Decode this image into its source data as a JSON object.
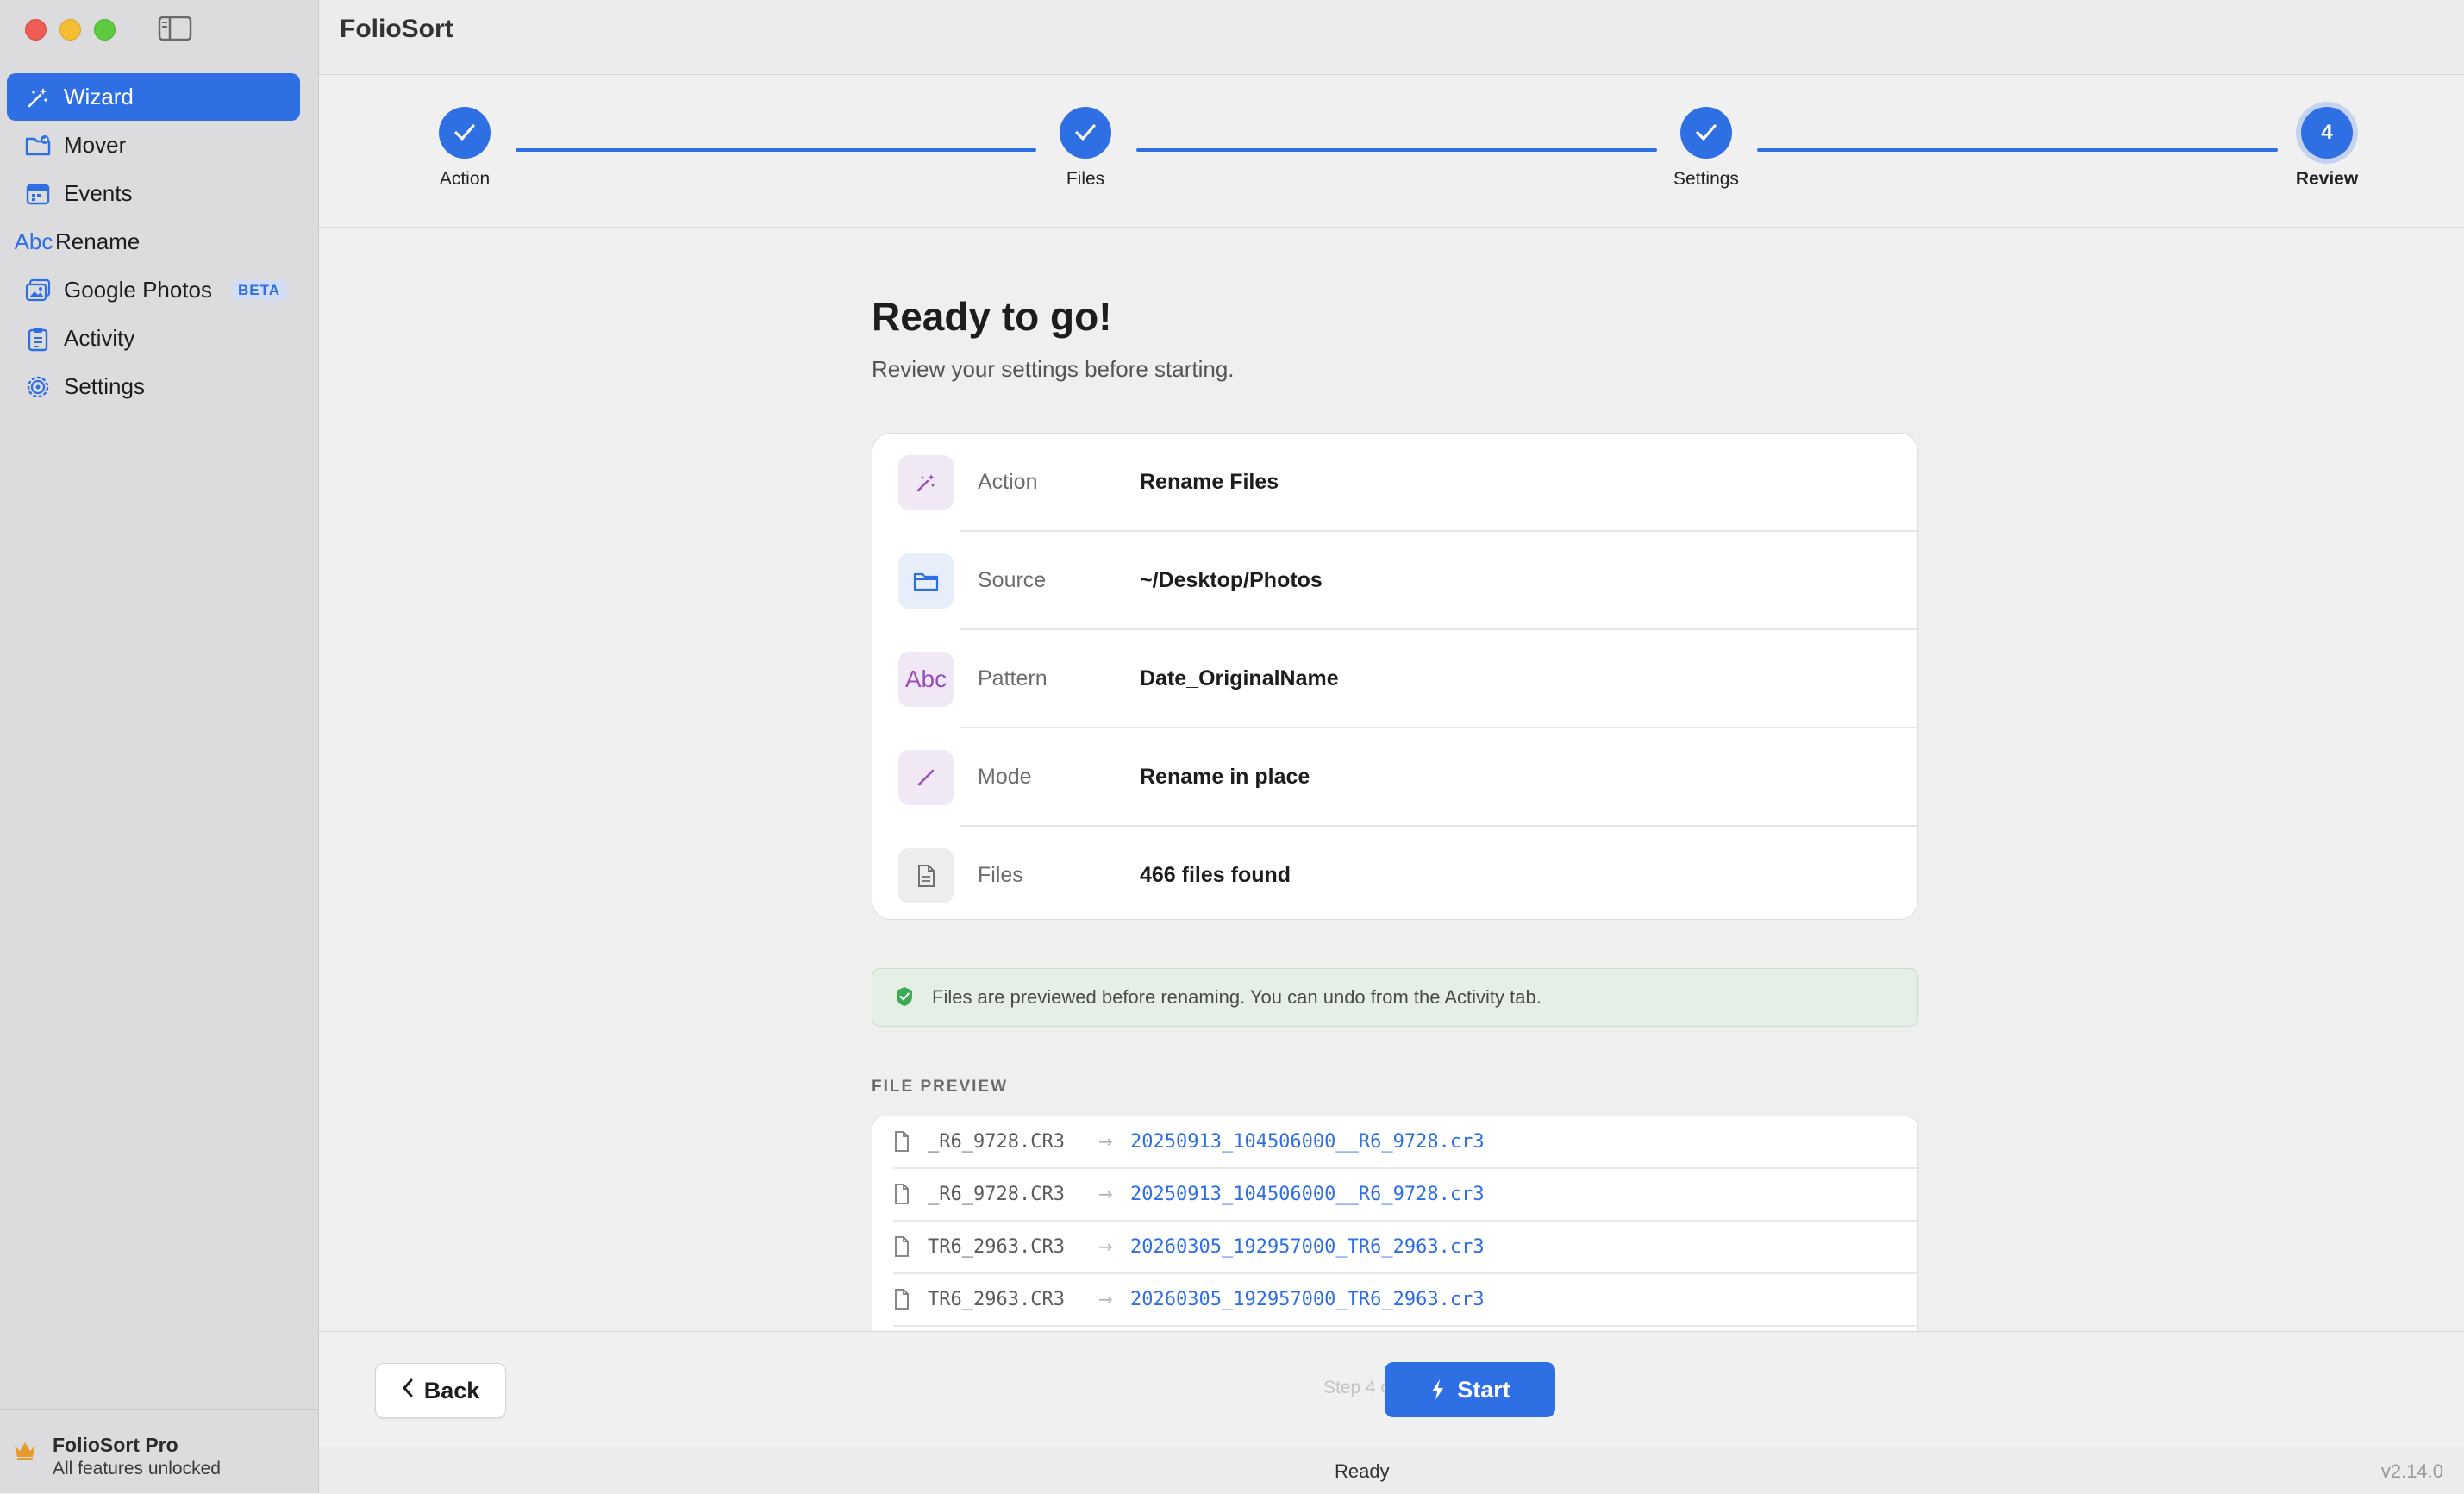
{
  "app": {
    "title": "FolioSort"
  },
  "sidebar": {
    "items": [
      {
        "label": "Wizard",
        "icon": "wand-icon",
        "active": true
      },
      {
        "label": "Mover",
        "icon": "folder-move-icon"
      },
      {
        "label": "Events",
        "icon": "calendar-icon"
      },
      {
        "label": "Rename",
        "icon": "abc-icon",
        "icon_text": "Abc"
      },
      {
        "label": "Google Photos",
        "icon": "photos-icon",
        "badge": "BETA"
      },
      {
        "label": "Activity",
        "icon": "clipboard-icon"
      },
      {
        "label": "Settings",
        "icon": "gear-icon"
      }
    ],
    "footer": {
      "title": "FolioSort Pro",
      "subtitle": "All features unlocked",
      "icon": "crown-icon"
    }
  },
  "stepper": {
    "steps": [
      {
        "label": "Action",
        "state": "done"
      },
      {
        "label": "Files",
        "state": "done"
      },
      {
        "label": "Settings",
        "state": "done"
      },
      {
        "label": "Review",
        "state": "current",
        "number": "4"
      }
    ]
  },
  "review": {
    "title": "Ready to go!",
    "subtitle": "Review your settings before starting.",
    "rows": [
      {
        "label": "Action",
        "value": "Rename Files",
        "icon": "wand-icon"
      },
      {
        "label": "Source",
        "value": "~/Desktop/Photos",
        "icon": "folder-icon"
      },
      {
        "label": "Pattern",
        "value": "Date_OriginalName",
        "icon": "abc-icon",
        "icon_text": "Abc"
      },
      {
        "label": "Mode",
        "value": "Rename in place",
        "icon": "pencil-icon"
      },
      {
        "label": "Files",
        "value": "466 files found",
        "icon": "document-icon"
      }
    ],
    "notice": "Files are previewed before renaming. You can undo from the Activity tab."
  },
  "file_preview": {
    "label": "FILE PREVIEW",
    "arrow": "→",
    "rows": [
      {
        "old": "_R6_9728.CR3",
        "new": "20250913_104506000__R6_9728.cr3"
      },
      {
        "old": "_R6_9728.CR3",
        "new": "20250913_104506000__R6_9728.cr3"
      },
      {
        "old": "TR6_2963.CR3",
        "new": "20260305_192957000_TR6_2963.cr3"
      },
      {
        "old": "TR6_2963.CR3",
        "new": "20260305_192957000_TR6_2963.cr3"
      }
    ]
  },
  "footer": {
    "back_label": "Back",
    "step_indicator": "Step 4 of 4",
    "start_label": "Start"
  },
  "status": {
    "text": "Ready",
    "version": "v2.14.0"
  },
  "colors": {
    "accent": "#2f6fe4",
    "notice_bg": "#e5efe6",
    "notice_icon": "#3aaa55"
  }
}
